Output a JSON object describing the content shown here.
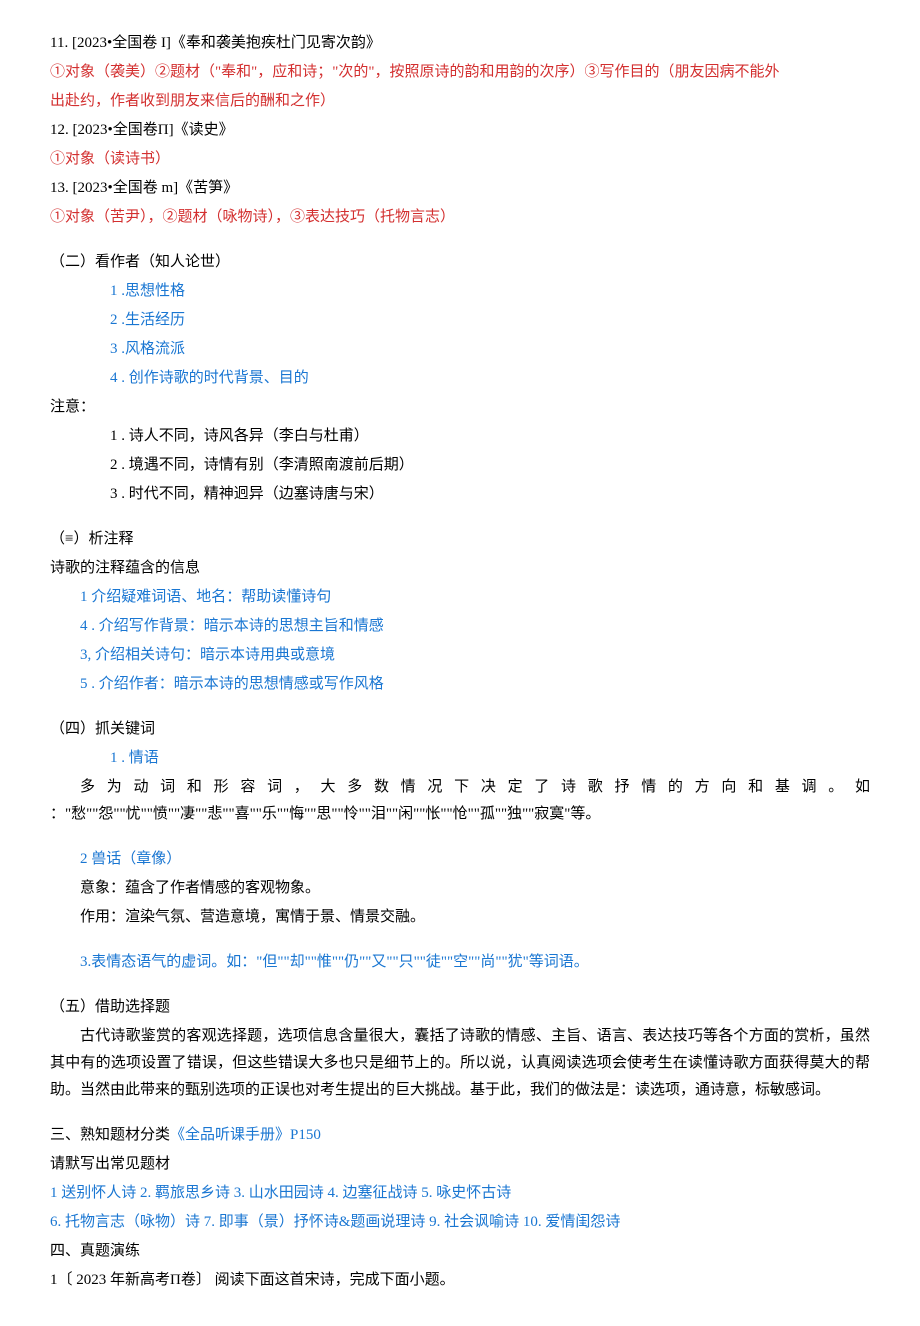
{
  "lines": {
    "l1": "11.   [2023•全国卷 I]《奉和袭美抱疾杜门见寄次韵》",
    "l2a": "①对象（袭美）②题材（\"奉和\"，应和诗；\"次的\"，按照原诗的韵和用韵的次序）③写作目的（朋友因病不能外",
    "l2b": "出赴约，作者收到朋友来信后的酬和之作）",
    "l3": "12.   [2023•全国卷Π]《读史》",
    "l4": "①对象（读诗书）",
    "l5": "13.   [2023•全国卷 m]《苦笋》",
    "l6": "①对象（苦尹），②题材（咏物诗），③表达技巧（托物言志）",
    "s2h": "（二）看作者（知人论世）",
    "s2_1": "1   .思想性格",
    "s2_2": "2   .生活经历",
    "s2_3": "3   .风格流派",
    "s2_4": "4   . 创作诗歌的时代背景、目的",
    "note_h": "注意：",
    "note_1": "1   . 诗人不同，诗风各异（李白与杜甫）",
    "note_2": "2   . 境遇不同，诗情有别（李清照南渡前后期）",
    "note_3": "3   . 时代不同，精神迥异（边塞诗唐与宋）",
    "s3h": "（≡）析注释",
    "s3sub": "诗歌的注释蕴含的信息",
    "s3_1": "1 介绍疑难词语、地名：帮助读懂诗句",
    "s3_2": "4   . 介绍写作背景：暗示本诗的思想主旨和情感",
    "s3_3": "3, 介绍相关诗句：暗示本诗用典或意境",
    "s3_4": "5   . 介绍作者：暗示本诗的思想情感或写作风格",
    "s4h": "（四）抓关键词",
    "s4_1": "1   . 情语",
    "s4p1": "多 为 动 词 和 形 容 词 ， 大 多 数 情 况 下 决 定 了 诗 歌 抒 情 的 方 向 和 基 调 。 如 ：\"愁\"\"怨\"\"忧\"\"愤\"\"凄\"\"悲\"\"喜\"\"乐\"\"悔\"\"思\"\"怜\"\"泪\"\"闲\"\"怅\"\"怆\"\"孤\"\"独\"\"寂寞\"等。",
    "s4_2": "2 兽话（章像）",
    "s4p2a": "意象：蕴含了作者情感的客观物象。",
    "s4p2b": "作用：渲染气氛、营造意境，寓情于景、情景交融。",
    "s4_3": "3.表情态语气的虚词。如：\"但\"\"却\"\"惟\"\"仍\"\"又\"\"只\"\"徒\"\"空\"\"尚\"\"犹\"等词语。",
    "s5h": "（五）借助选择题",
    "s5p": "古代诗歌鉴赏的客观选择题，选项信息含量很大，囊括了诗歌的情感、主旨、语言、表达技巧等各个方面的赏析，虽然其中有的选项设置了错误，但这些错误大多也只是细节上的。所以说，认真阅读选项会使考生在读懂诗歌方面获得莫大的帮助。当然由此带来的甄别选项的正误也对考生提出的巨大挑战。基于此，我们的做法是：读选项，通诗意，标敏感词。",
    "t3a": "三、熟知题材分类",
    "t3b": "《全品听课手册》P150",
    "t3sub": "请默写出常见题材",
    "t3l1": "1 送别怀人诗 2. 羁旅思乡诗 3. 山水田园诗 4. 边塞征战诗 5. 咏史怀古诗",
    "t3l2": "6. 托物言志（咏物）诗 7. 即事（景）抒怀诗&题画说理诗 9. 社会讽喻诗 10. 爱情闺怨诗",
    "t4": "四、真题演练",
    "t4l": "1〔 2023 年新高考Π卷〕 阅读下面这首宋诗，完成下面小题。"
  }
}
